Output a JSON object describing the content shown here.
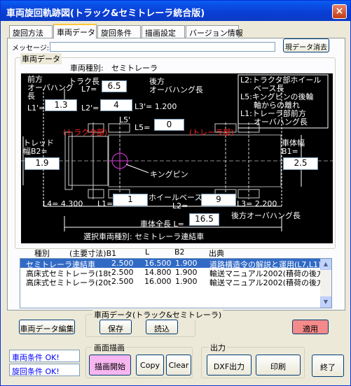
{
  "window": {
    "title": "車両旋回軌跡図(トラック&セミトレーラ統合版)",
    "close_glyph": "×"
  },
  "tabs": [
    "旋回方法",
    "車両データ",
    "旋回条件",
    "描画設定",
    "バージョン情報"
  ],
  "message": {
    "label": "メッセージ:",
    "value": "",
    "clear_button": "現データ消去"
  },
  "vehicle_group": {
    "title": "車両データ",
    "type_label": "車両種別:",
    "type_value": "セミトレーラ"
  },
  "diagram": {
    "front_overhang_label": [
      "前方",
      "オーバハング",
      "長"
    ],
    "truck_length_label": "トラク長",
    "L7_label": "L7=",
    "L7": "6.5",
    "rear_overhang_label": [
      "後方",
      "オーバハング長"
    ],
    "L1p_label": "L1'=",
    "L1p": "1.3",
    "L2p_label": "L2'=",
    "L2p": "4",
    "L3p": "L3'= 1.200",
    "L5p_label": "L5'",
    "L5_label": "L5=",
    "L5": "0",
    "legend": [
      "L2:トラクタ部ホイール",
      "ベース長",
      "L5:キングピンの後輪",
      "軸からの離れ",
      "L1:トレーラ部前方",
      "オーバハング長"
    ],
    "tractor_part": "(トラクタ部)",
    "trailer_part": "(トレーラ部)",
    "tread_label": [
      "トレッド",
      "幅B2="
    ],
    "B2": "1.9",
    "body_width_label": [
      "車体幅",
      "B1="
    ],
    "B1": "2.5",
    "kingpin_label": "キングピン",
    "L4": "L4= 4.300",
    "L1_label": "L1=",
    "L1": "1",
    "wheelbase_label": [
      "ホイールベース",
      "L2="
    ],
    "L2": "9",
    "L3": "L3= 2.200",
    "rear_overhang_bottom": "後方オーバハング長",
    "total_length_label": "車体全長 L=",
    "total_length": "16.5",
    "selected_type": "選択車両種別:  セミトレーラ連結車"
  },
  "list": {
    "headers": [
      "種別",
      "(主要寸法)B1",
      "L",
      "B2",
      "出典"
    ],
    "rows": [
      [
        "セミトレーラ連結車",
        "2.500",
        "16.500",
        "1.900",
        "道路構造令の解説と運用(L7,L1)"
      ],
      [
        "高床式セミトレーラ(18t",
        "2.500",
        "14.800",
        "1.900",
        "輸送マニュアル2002(積荷の後方突"
      ],
      [
        "高床式セミトレーラ(20t",
        "2.500",
        "16.000",
        "1.900",
        "輸送マニュアル2002(積荷の後方突"
      ]
    ],
    "selected_index": 0
  },
  "buttons": {
    "edit": "車両データ編集",
    "vehicle_data_group": "車両データ(トラック&セミトレーラ)",
    "save": "保存",
    "load": "読込",
    "apply": "適用",
    "draw_group": "画面描画",
    "draw_start": "描画開始",
    "copy": "Copy",
    "clear": "Clear",
    "output_group": "出力",
    "dxf": "DXF出力",
    "print": "印刷",
    "exit": "終了"
  },
  "status": {
    "vehicle": "車両条件 OK!",
    "turning": "旋回条件 OK!"
  },
  "colors": {
    "apply_bg": "#f48a8a",
    "draw_bg": "#f7b6f0",
    "status_text": "#0000ff",
    "red_text": "#ff2020"
  }
}
